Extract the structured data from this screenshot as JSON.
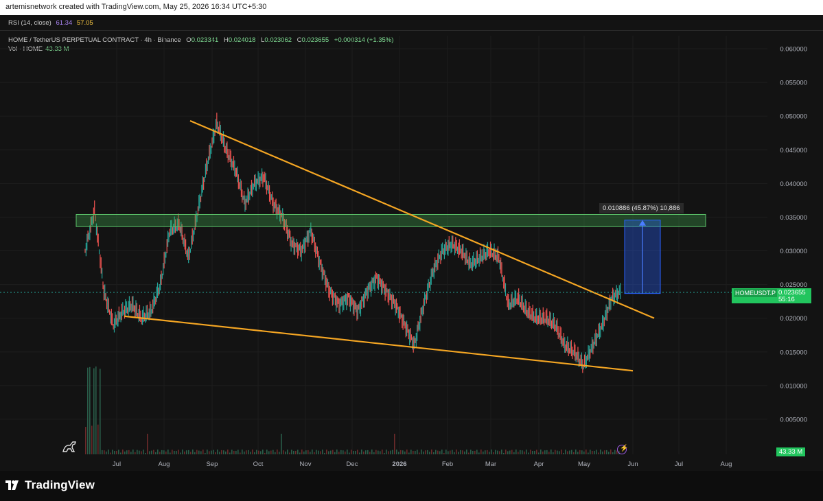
{
  "header": {
    "attribution": "artemisnetwork created with TradingView.com, May 25, 2026 16:34 UTC+5:30"
  },
  "rsi": {
    "label": "RSI (14, close)",
    "value1": "61.34",
    "value2": "57.05"
  },
  "legend": {
    "symbol": "HOME / TetherUS PERPETUAL CONTRACT · 4h · Binance",
    "open_k": "O",
    "open": "0.023341",
    "high_k": "H",
    "high": "0.024018",
    "low_k": "L",
    "low": "0.023062",
    "close_k": "C",
    "close": "0.023655",
    "change": "+0.000314 (+1.35%)"
  },
  "volume": {
    "label": "Vol · HOME",
    "value": "43.33 M"
  },
  "price_tag": {
    "symbol": "HOMEUSDT.P",
    "price": "0.023655",
    "countdown": "55:16"
  },
  "volume_tag": "43.33 M",
  "measure_label": "0.010886 (45.87%) 10,886",
  "brand": "TradingView",
  "colors": {
    "background": "#131313",
    "trendline": "#f5a623",
    "zone": "#3fa34d",
    "measure": "#2962ff",
    "up": "#26a69a",
    "down": "#ef5350",
    "tag": "#22c55e"
  },
  "chart_data": {
    "type": "line",
    "title": "HOME / TetherUS PERPETUAL CONTRACT · 4h · Binance",
    "y_ticks": [
      "0.060000",
      "0.055000",
      "0.050000",
      "0.045000",
      "0.040000",
      "0.035000",
      "0.030000",
      "0.025000",
      "0.020000",
      "0.015000",
      "0.010000",
      "0.005000"
    ],
    "x_ticks": [
      "Jul",
      "Aug",
      "Sep",
      "Oct",
      "Nov",
      "Dec",
      "2026",
      "Feb",
      "Mar",
      "Apr",
      "May",
      "Jun",
      "Jul",
      "Aug"
    ],
    "ylim": [
      0,
      0.062
    ],
    "series": [
      {
        "values": [
          0.03,
          0.036,
          0.024,
          0.019,
          0.021,
          0.022,
          0.02,
          0.021,
          0.025,
          0.033,
          0.034,
          0.029,
          0.036,
          0.043,
          0.049,
          0.045,
          0.042,
          0.037,
          0.04,
          0.041,
          0.037,
          0.035,
          0.031,
          0.03,
          0.033,
          0.028,
          0.024,
          0.022,
          0.023,
          0.021,
          0.024,
          0.026,
          0.024,
          0.022,
          0.019,
          0.016,
          0.022,
          0.027,
          0.03,
          0.031,
          0.03,
          0.028,
          0.029,
          0.03,
          0.029,
          0.022,
          0.023,
          0.021,
          0.02,
          0.02,
          0.019,
          0.016,
          0.015,
          0.013,
          0.016,
          0.019,
          0.023,
          0.024
        ]
      }
    ],
    "trendlines": [
      {
        "from": [
          "2025-08-18",
          0.0493
        ],
        "to": [
          "2026-05-24",
          0.02
        ]
      },
      {
        "from": [
          "2025-06-30",
          0.0203
        ],
        "to": [
          "2026-05-24",
          0.0122
        ]
      }
    ],
    "resistance_zone": [
      0.0336,
      0.0354
    ],
    "measure": {
      "from": 0.02367,
      "to": 0.03456,
      "label": "0.010886 (45.87%) 10,886"
    },
    "grid": true,
    "legend": "top-left"
  }
}
